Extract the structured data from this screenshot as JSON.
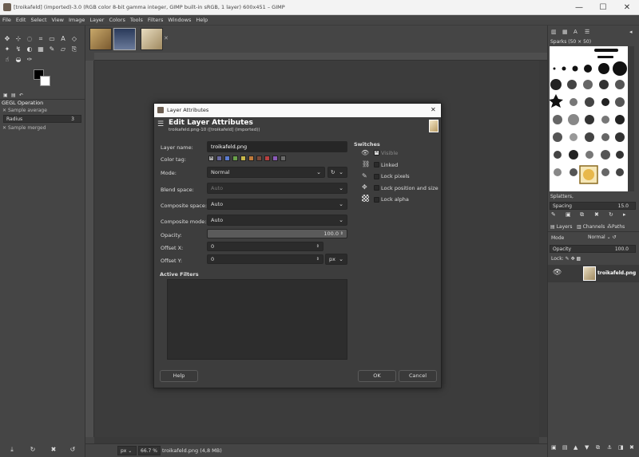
{
  "window": {
    "title": "[troikafeld] (imported)-3.0 (RGB color 8-bit gamma integer, GIMP built-in sRGB, 1 layer) 600x451 – GIMP",
    "minimize": "—",
    "maximize": "☐",
    "close": "✕"
  },
  "menu": [
    "File",
    "Edit",
    "Select",
    "View",
    "Image",
    "Layer",
    "Colors",
    "Tools",
    "Filters",
    "Windows",
    "Help"
  ],
  "left_dock": {
    "panel_title": "GEGL Operation",
    "option1": "Sample average",
    "radius_label": "Radius",
    "radius_value": "3",
    "option2": "Sample merged"
  },
  "image_tabs": {
    "close": "✕"
  },
  "statusbar": {
    "unit": "px",
    "zoom": "66.7 %",
    "file": "troikafeld.png (4,8 MB)"
  },
  "right_dock": {
    "brush_title": "Sparks (50 × 50)",
    "brush_name": "Splatters,",
    "spacing_label": "Spacing",
    "spacing_value": "15.0",
    "tab_layers": "Layers",
    "tab_channels": "Channels",
    "tab_paths": "Paths",
    "mode_label": "Mode",
    "mode_value": "Normal",
    "opacity_label": "Opacity",
    "opacity_value": "100.0",
    "lock_label": "Lock:",
    "layer_name": "troikafeld.png"
  },
  "dialog": {
    "title": "Layer Attributes",
    "close": "✕",
    "heading": "Edit Layer Attributes",
    "subheading": "troikafeld.png-10 ([troikafeld] (imported))",
    "labels": {
      "layer_name": "Layer name:",
      "color_tag": "Color tag:",
      "mode": "Mode:",
      "blend_space": "Blend space:",
      "composite_space": "Composite space:",
      "composite_mode": "Composite mode:",
      "opacity": "Opacity:",
      "offset_x": "Offset X:",
      "offset_y": "Offset Y:"
    },
    "values": {
      "layer_name": "troikafeld.png",
      "mode": "Normal",
      "blend_space": "Auto",
      "composite_space": "Auto",
      "composite_mode": "Auto",
      "opacity": "100.0",
      "offset_x": "0",
      "offset_y": "0",
      "unit": "px"
    },
    "color_tags": [
      "#6a6aa0",
      "#5b7bd0",
      "#6aa04a",
      "#c8b84a",
      "#c07a3a",
      "#7a4a3a",
      "#b84040",
      "#8a5ab8",
      "#6a6a6a"
    ],
    "active_filters": "Active Filters",
    "switches": {
      "title": "Switches",
      "visible": "Visible",
      "linked": "Linked",
      "lock_pixels": "Lock pixels",
      "lock_position": "Lock position and size",
      "lock_alpha": "Lock alpha"
    },
    "buttons": {
      "help": "Help",
      "ok": "OK",
      "cancel": "Cancel"
    }
  }
}
